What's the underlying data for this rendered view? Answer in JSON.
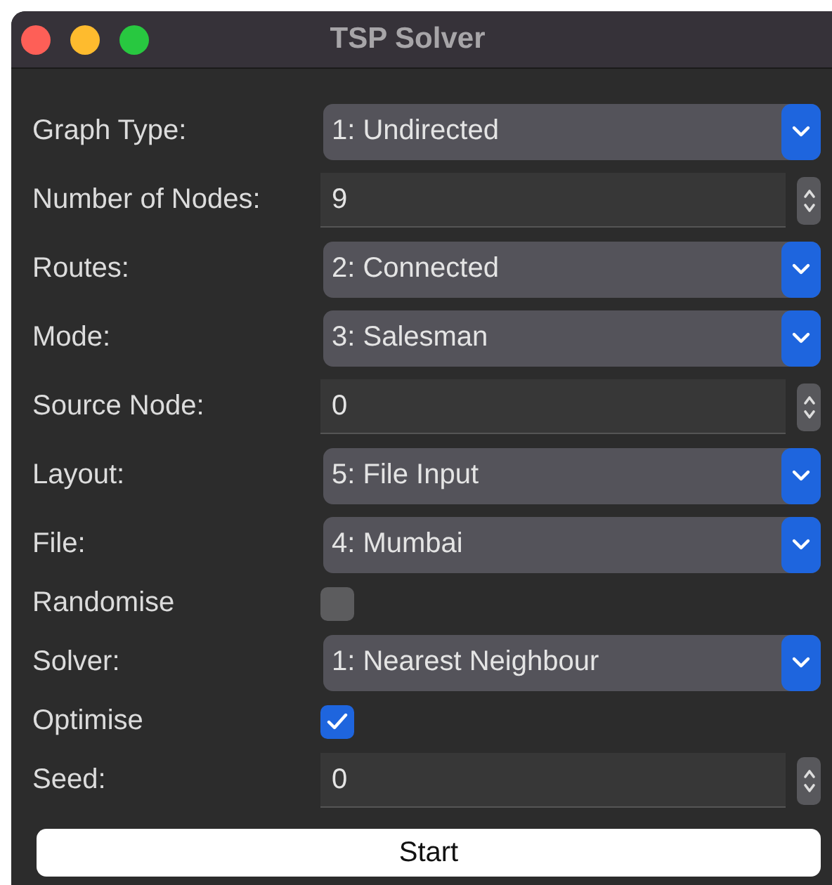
{
  "window": {
    "title": "TSP Solver"
  },
  "fields": [
    {
      "kind": "dropdown",
      "label": "Graph Type:",
      "value": "1: Undirected"
    },
    {
      "kind": "spinbox",
      "label": "Number of Nodes:",
      "value": "9"
    },
    {
      "kind": "dropdown",
      "label": "Routes:",
      "value": "2: Connected"
    },
    {
      "kind": "dropdown",
      "label": "Mode:",
      "value": "3: Salesman"
    },
    {
      "kind": "spinbox",
      "label": "Source Node:",
      "value": "0"
    },
    {
      "kind": "dropdown",
      "label": "Layout:",
      "value": "5: File Input"
    },
    {
      "kind": "dropdown",
      "label": "File:",
      "value": "4: Mumbai"
    },
    {
      "kind": "checkbox",
      "label": "Randomise",
      "checked": false
    },
    {
      "kind": "dropdown",
      "label": "Solver:",
      "value": "1: Nearest Neighbour"
    },
    {
      "kind": "checkbox",
      "label": "Optimise",
      "checked": true
    },
    {
      "kind": "spinbox",
      "label": "Seed:",
      "value": "0"
    }
  ],
  "buttons": [
    "Start"
  ]
}
